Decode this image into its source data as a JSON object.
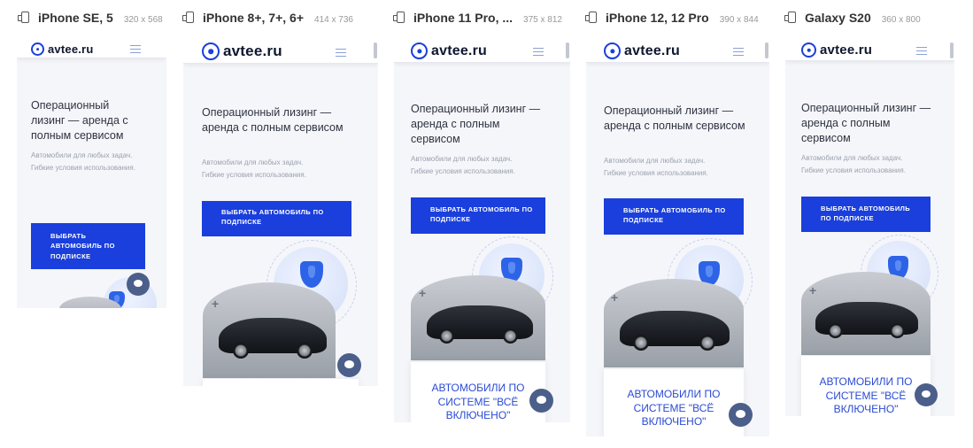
{
  "devices": [
    {
      "name": "iPhone SE, 5",
      "size": "320 x 568"
    },
    {
      "name": "iPhone 8+, 7+, 6+",
      "size": "414 x 736"
    },
    {
      "name": "iPhone 11 Pro, ...",
      "size": "375 x 812"
    },
    {
      "name": "iPhone 12, 12 Pro",
      "size": "390 x 844"
    },
    {
      "name": "Galaxy S20",
      "size": "360 x 800"
    }
  ],
  "site": {
    "logo": "avtee.ru",
    "headline": "Операционный лизинг — аренда с полным сервисом",
    "subtitle_1": "Автомобили для любых задач.",
    "subtitle_2": "Гибкие условия использования.",
    "cta": "Выбрать автомобиль по подписке",
    "card": "Автомобили по системе \"всё включено\""
  },
  "colors": {
    "brand": "#1a3fdc",
    "chat": "#4b5f8a",
    "card_text": "#2b4bd4"
  },
  "icons": [
    "device-icon",
    "menu-icon",
    "shield-icon",
    "chat-icon",
    "plus-icon"
  ]
}
